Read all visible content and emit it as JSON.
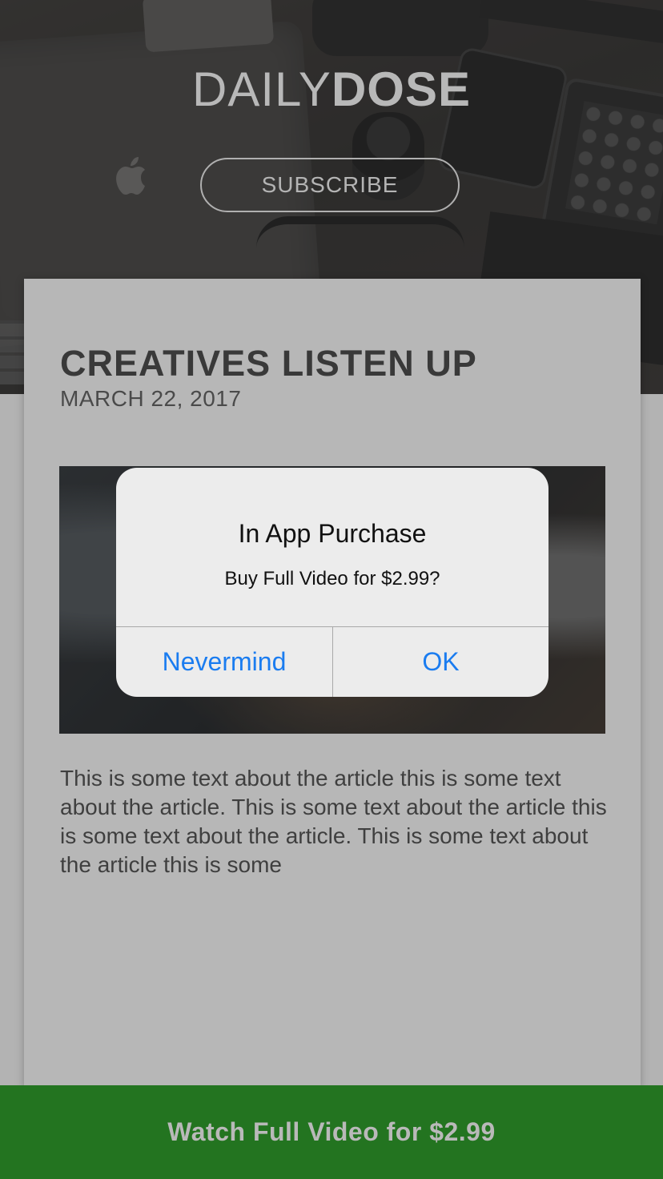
{
  "header": {
    "brand_light": "DAILY",
    "brand_bold": "DOSE",
    "subscribe_label": "SUBSCRIBE"
  },
  "article": {
    "title": "CREATIVES LISTEN UP",
    "date": "MARCH 22, 2017",
    "body": "This is some text about the article this is some text about the article. This is some text about the article this is some text about the article. This is some text about the article this is some"
  },
  "alert": {
    "title": "In App Purchase",
    "message": "Buy Full Video for $2.99?",
    "cancel_label": "Nevermind",
    "confirm_label": "OK"
  },
  "cta": {
    "label": "Watch Full Video for $2.99"
  },
  "colors": {
    "cta_green": "#237420",
    "alert_button_blue": "#1a7cf0",
    "card_gray": "#b7b7b7"
  },
  "icons": {
    "hero_logo": "apple-logo-icon"
  }
}
